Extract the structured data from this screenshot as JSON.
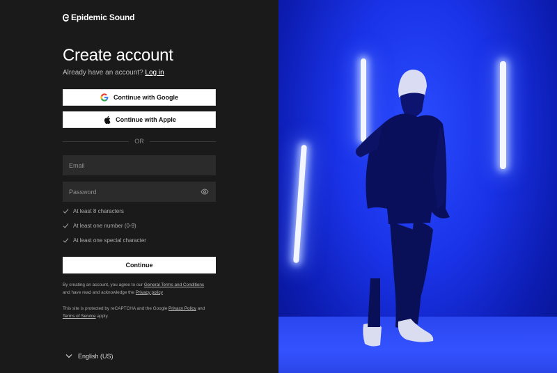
{
  "brand": {
    "name": "Epidemic Sound"
  },
  "heading": {
    "title": "Create account"
  },
  "login_prompt": {
    "text": "Already have an account?",
    "link": "Log in"
  },
  "sso": {
    "google_label": "Continue with Google",
    "apple_label": "Continue with Apple"
  },
  "divider": {
    "label": "OR"
  },
  "form": {
    "email_placeholder": "Email",
    "password_placeholder": "Password"
  },
  "password_rules": [
    {
      "label": "At least 8 characters"
    },
    {
      "label": "At least one number (0-9)"
    },
    {
      "label": "At least one special character"
    }
  ],
  "continue_label": "Continue",
  "legal": {
    "terms_prefix": "By creating an account, you agree to our",
    "terms_link": "General Terms and Conditions",
    "terms_middle": "and have read and acknowledge the",
    "privacy_link": "Privacy policy",
    "recaptcha_prefix": "This site is protected by reCAPTCHA and the Google",
    "google_privacy_link": "Privacy Policy",
    "recaptcha_and": "and",
    "google_terms_link": "Terms of Service",
    "recaptcha_suffix": "apply."
  },
  "language": {
    "label": "English (US)"
  },
  "colors": {
    "background": "#1a1a1a",
    "field": "#2b2b2b",
    "photo_blue": "#1a33e8"
  },
  "icons": [
    "epidemic-logo-icon",
    "google-icon",
    "apple-icon",
    "eye-icon",
    "check-icon",
    "chevron-down-icon"
  ]
}
